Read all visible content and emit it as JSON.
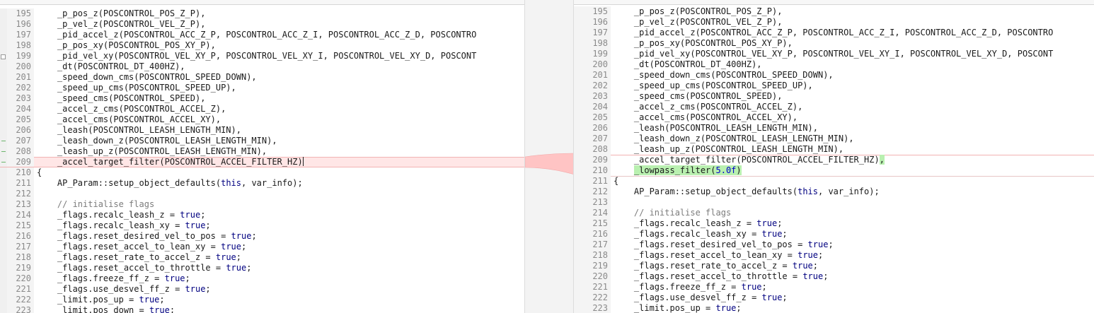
{
  "left": {
    "lines": [
      {
        "n": "195",
        "code": "    _p_pos_z(POSCONTROL_POS_Z_P),"
      },
      {
        "n": "196",
        "code": "    _p_vel_z(POSCONTROL_VEL_Z_P),"
      },
      {
        "n": "197",
        "code": "    _pid_accel_z(POSCONTROL_ACC_Z_P, POSCONTROL_ACC_Z_I, POSCONTROL_ACC_Z_D, POSCONTRO"
      },
      {
        "n": "198",
        "code": "    _p_pos_xy(POSCONTROL_POS_XY_P),"
      },
      {
        "n": "199",
        "code": "    _pid_vel_xy(POSCONTROL_VEL_XY_P, POSCONTROL_VEL_XY_I, POSCONTROL_VEL_XY_D, POSCONT"
      },
      {
        "n": "200",
        "code": "    _dt(POSCONTROL_DT_400HZ),"
      },
      {
        "n": "201",
        "code": "    _speed_down_cms(POSCONTROL_SPEED_DOWN),"
      },
      {
        "n": "202",
        "code": "    _speed_up_cms(POSCONTROL_SPEED_UP),"
      },
      {
        "n": "203",
        "code": "    _speed_cms(POSCONTROL_SPEED),"
      },
      {
        "n": "204",
        "code": "    _accel_z_cms(POSCONTROL_ACCEL_Z),"
      },
      {
        "n": "205",
        "code": "    _accel_cms(POSCONTROL_ACCEL_XY),"
      },
      {
        "n": "206",
        "code": "    _leash(POSCONTROL_LEASH_LENGTH_MIN),"
      },
      {
        "n": "207",
        "code": "    _leash_down_z(POSCONTROL_LEASH_LENGTH_MIN),"
      },
      {
        "n": "208",
        "code": "    _leash_up_z(POSCONTROL_LEASH_LENGTH_MIN),"
      },
      {
        "n": "209",
        "code": "    _accel_target_filter(POSCONTROL_ACCEL_FILTER_HZ)"
      },
      {
        "n": "210",
        "code": "{"
      },
      {
        "n": "211",
        "code": "    AP_Param::setup_object_defaults(",
        "kw": "this",
        "tail": ", var_info);"
      },
      {
        "n": "212",
        "code": ""
      },
      {
        "n": "213",
        "comment": "    // initialise flags"
      },
      {
        "n": "214",
        "code": "    _flags.recalc_leash_z = ",
        "kw": "true",
        "tail": ";"
      },
      {
        "n": "215",
        "code": "    _flags.recalc_leash_xy = ",
        "kw": "true",
        "tail": ";"
      },
      {
        "n": "216",
        "code": "    _flags.reset_desired_vel_to_pos = ",
        "kw": "true",
        "tail": ";"
      },
      {
        "n": "217",
        "code": "    _flags.reset_accel_to_lean_xy = ",
        "kw": "true",
        "tail": ";"
      },
      {
        "n": "218",
        "code": "    _flags.reset_rate_to_accel_z = ",
        "kw": "true",
        "tail": ";"
      },
      {
        "n": "219",
        "code": "    _flags.reset_accel_to_throttle = ",
        "kw": "true",
        "tail": ";"
      },
      {
        "n": "220",
        "code": "    _flags.freeze_ff_z = ",
        "kw": "true",
        "tail": ";"
      },
      {
        "n": "221",
        "code": "    _flags.use_desvel_ff_z = ",
        "kw": "true",
        "tail": ";"
      },
      {
        "n": "222",
        "code": "    _limit.pos_up = ",
        "kw": "true",
        "tail": ";"
      },
      {
        "n": "223",
        "code": "    _limit.pos_down = ",
        "kw": "true",
        "tail": ";"
      }
    ]
  },
  "right": {
    "lines": [
      {
        "n": "195",
        "code": "    _p_pos_z(POSCONTROL_POS_Z_P),"
      },
      {
        "n": "196",
        "code": "    _p_vel_z(POSCONTROL_VEL_Z_P),"
      },
      {
        "n": "197",
        "code": "    _pid_accel_z(POSCONTROL_ACC_Z_P, POSCONTROL_ACC_Z_I, POSCONTROL_ACC_Z_D, POSCONTRO"
      },
      {
        "n": "198",
        "code": "    _p_pos_xy(POSCONTROL_POS_XY_P),"
      },
      {
        "n": "199",
        "code": "    _pid_vel_xy(POSCONTROL_VEL_XY_P, POSCONTROL_VEL_XY_I, POSCONTROL_VEL_XY_D, POSCONT"
      },
      {
        "n": "200",
        "code": "    _dt(POSCONTROL_DT_400HZ),"
      },
      {
        "n": "201",
        "code": "    _speed_down_cms(POSCONTROL_SPEED_DOWN),"
      },
      {
        "n": "202",
        "code": "    _speed_up_cms(POSCONTROL_SPEED_UP),"
      },
      {
        "n": "203",
        "code": "    _speed_cms(POSCONTROL_SPEED),"
      },
      {
        "n": "204",
        "code": "    _accel_z_cms(POSCONTROL_ACCEL_Z),"
      },
      {
        "n": "205",
        "code": "    _accel_cms(POSCONTROL_ACCEL_XY),"
      },
      {
        "n": "206",
        "code": "    _leash(POSCONTROL_LEASH_LENGTH_MIN),"
      },
      {
        "n": "207",
        "code": "    _leash_down_z(POSCONTROL_LEASH_LENGTH_MIN),"
      },
      {
        "n": "208",
        "code": "    _leash_up_z(POSCONTROL_LEASH_LENGTH_MIN),"
      },
      {
        "n": "209",
        "code": "    _accel_target_filter(POSCONTROL_ACCEL_FILTER_HZ)",
        "added": ","
      },
      {
        "n": "210",
        "code": "    ",
        "added": "_lowpass_filter(",
        "num": "5.0f",
        "added_tail": ")"
      },
      {
        "n": "211",
        "code": "{"
      },
      {
        "n": "212",
        "code": "    AP_Param::setup_object_defaults(",
        "kw": "this",
        "tail": ", var_info);"
      },
      {
        "n": "213",
        "code": ""
      },
      {
        "n": "214",
        "comment": "    // initialise flags"
      },
      {
        "n": "215",
        "code": "    _flags.recalc_leash_z = ",
        "kw": "true",
        "tail": ";"
      },
      {
        "n": "216",
        "code": "    _flags.recalc_leash_xy = ",
        "kw": "true",
        "tail": ";"
      },
      {
        "n": "217",
        "code": "    _flags.reset_desired_vel_to_pos = ",
        "kw": "true",
        "tail": ";"
      },
      {
        "n": "218",
        "code": "    _flags.reset_accel_to_lean_xy = ",
        "kw": "true",
        "tail": ";"
      },
      {
        "n": "219",
        "code": "    _flags.reset_rate_to_accel_z = ",
        "kw": "true",
        "tail": ";"
      },
      {
        "n": "220",
        "code": "    _flags.reset_accel_to_throttle = ",
        "kw": "true",
        "tail": ";"
      },
      {
        "n": "221",
        "code": "    _flags.freeze_ff_z = ",
        "kw": "true",
        "tail": ";"
      },
      {
        "n": "222",
        "code": "    _flags.use_desvel_ff_z = ",
        "kw": "true",
        "tail": ";"
      },
      {
        "n": "223",
        "code": "    _limit.pos_up = ",
        "kw": "true",
        "tail": ";"
      }
    ]
  }
}
